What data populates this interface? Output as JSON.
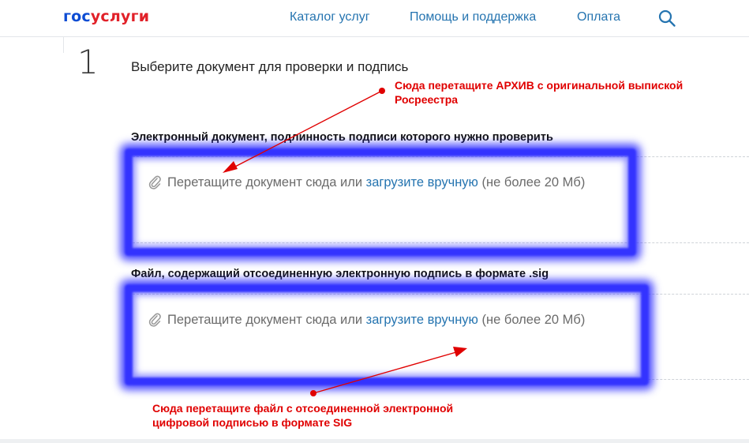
{
  "header": {
    "logo_part1": "гос",
    "logo_part2": "услуги",
    "nav": [
      {
        "label": "Каталог услуг"
      },
      {
        "label": "Помощь и поддержка"
      },
      {
        "label": "Оплата"
      }
    ],
    "search_icon": "search-icon",
    "colors": {
      "brand_blue": "#0d4cd3",
      "brand_red": "#e12028",
      "link": "#2574b0"
    }
  },
  "step": {
    "number": "1",
    "title": "Выберите документ для проверки и подпись"
  },
  "fields": [
    {
      "label": "Электронный документ, подлинность подписи которого нужно проверить",
      "drop_text": "Перетащите документ сюда или",
      "link_text": "загрузите вручную",
      "limit_text": "(не более 20 Мб)",
      "icon": "paperclip-icon"
    },
    {
      "label": "Файл, содержащий отсоединенную электронную подпись в формате .sig",
      "drop_text": "Перетащите документ сюда или",
      "link_text": "загрузите вручную",
      "limit_text": "(не более 20 Мб)",
      "icon": "paperclip-icon"
    }
  ],
  "annotations": {
    "top_line1": "Сюда перетащите АРХИВ с оригинальной выпиской",
    "top_line2": "Росреестра",
    "bottom_line1": "Сюда перетащите файл с отсоединенной электронной",
    "bottom_line2": "цифровой подписью в формате SIG",
    "color": "#e00000",
    "highlight_color": "#3333ff"
  }
}
